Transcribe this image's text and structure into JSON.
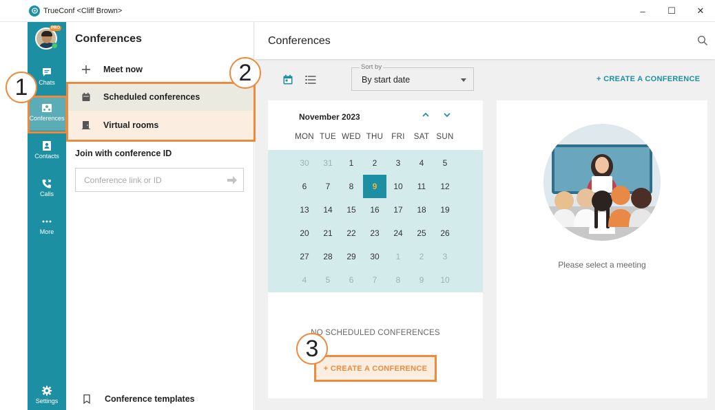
{
  "window": {
    "title": "TrueConf <Cliff Brown>",
    "controls": {
      "minimize": "–",
      "maximize": "☐",
      "close": "✕"
    }
  },
  "rail": {
    "pro_badge": "PRO",
    "items": [
      {
        "label": "Chats",
        "icon": "chat-icon"
      },
      {
        "label": "Conferences",
        "icon": "conferences-icon",
        "active": true
      },
      {
        "label": "Contacts",
        "icon": "contacts-icon"
      },
      {
        "label": "Calls",
        "icon": "calls-icon"
      },
      {
        "label": "More",
        "icon": "more-icon"
      },
      {
        "label": "Settings",
        "icon": "settings-icon"
      }
    ]
  },
  "mid": {
    "title": "Conferences",
    "meet_now": "Meet now",
    "scheduled": "Scheduled conferences",
    "virtual_rooms": "Virtual rooms",
    "join_title": "Join with conference ID",
    "join_placeholder": "Conference link or ID",
    "templates": "Conference templates"
  },
  "main": {
    "title": "Conferences",
    "sort_label": "Sort by",
    "sort_value": "By start date",
    "create_top": "+ CREATE A CONFERENCE",
    "calendar": {
      "month": "November 2023",
      "days": [
        "MON",
        "TUE",
        "WED",
        "THU",
        "FRI",
        "SAT",
        "SUN"
      ],
      "weeks": [
        [
          "30",
          "31",
          "1",
          "2",
          "3",
          "4",
          "5"
        ],
        [
          "6",
          "7",
          "8",
          "9",
          "10",
          "11",
          "12"
        ],
        [
          "13",
          "14",
          "15",
          "16",
          "17",
          "18",
          "19"
        ],
        [
          "20",
          "21",
          "22",
          "23",
          "24",
          "25",
          "26"
        ],
        [
          "27",
          "28",
          "29",
          "30",
          "1",
          "2",
          "3"
        ],
        [
          "4",
          "5",
          "6",
          "7",
          "8",
          "9",
          "10"
        ]
      ],
      "today": "9"
    },
    "empty_text": "NO SCHEDULED CONFERENCES",
    "create_bottom": "+ CREATE A CONFERENCE",
    "detail_text": "Please select a meeting"
  },
  "annotations": {
    "n1": "1",
    "n2": "2",
    "n3": "3"
  },
  "colors": {
    "accent": "#1d8fa3",
    "highlight": "#ee8a3b",
    "calendar_bg": "#d3ebeb"
  }
}
